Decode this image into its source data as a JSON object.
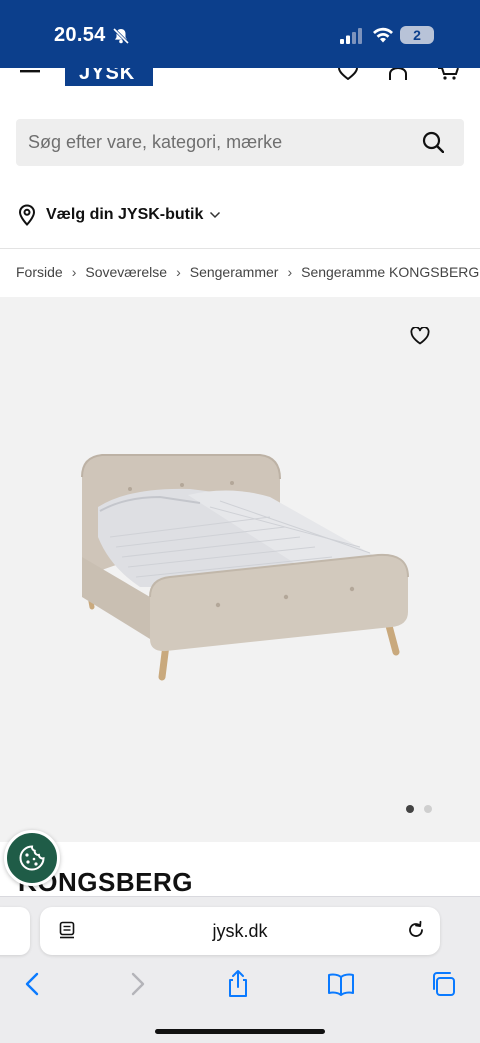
{
  "status_bar": {
    "time": "20.54",
    "notifications_badge": "2",
    "icons": [
      "bell-slash-icon",
      "cellular-signal-icon",
      "wifi-icon",
      "battery-icon"
    ],
    "background": "#0c3f8c"
  },
  "header": {
    "logo_text": "JYSK",
    "icons": [
      "menu-icon",
      "heart-icon",
      "user-icon",
      "cart-icon"
    ]
  },
  "search": {
    "placeholder": "Søg efter vare, kategori, mærke"
  },
  "store": {
    "label": "Vælg din JYSK-butik"
  },
  "breadcrumb": {
    "items": [
      "Forside",
      "Soveværelse",
      "Sengerammer",
      "Sengeramme KONGSBERG"
    ],
    "separator": "›"
  },
  "gallery": {
    "image_count": 2,
    "active_index": 0
  },
  "product": {
    "title": "KONGSBERG"
  },
  "browser": {
    "url": "jysk.dk",
    "toolbar_icons": [
      "back-icon",
      "forward-icon",
      "share-icon",
      "bookmarks-icon",
      "tabs-icon"
    ]
  },
  "colors": {
    "brand_blue": "#0c3f8c",
    "cookie_green": "#1f5c47",
    "ios_blue": "#0a7aff"
  }
}
